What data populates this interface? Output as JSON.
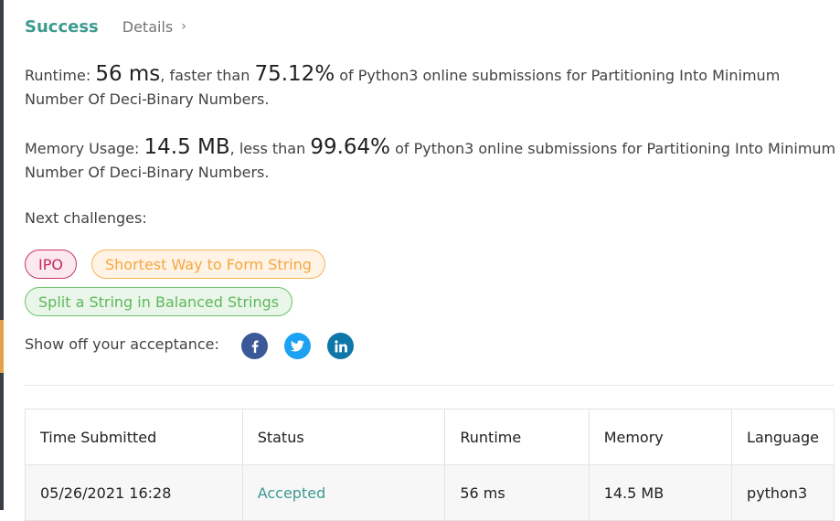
{
  "header": {
    "status": "Success",
    "details_label": "Details",
    "details_chevron": "›"
  },
  "runtime": {
    "label": "Runtime:",
    "value": "56 ms",
    "comparison": ", faster than",
    "percent": "75.12%",
    "description": "of Python3 online submissions for Partitioning Into Minimum Number Of Deci-Binary Numbers."
  },
  "memory": {
    "label": "Memory Usage:",
    "value": "14.5 MB",
    "comparison": ", less than",
    "percent": "99.64%",
    "description": "of Python3 online submissions for Partitioning Into Minimum Number Of Deci-Binary Numbers."
  },
  "next_challenges": {
    "label": "Next challenges:",
    "items": [
      {
        "label": "IPO",
        "difficulty_color": "#c12a5c"
      },
      {
        "label": "Shortest Way to Form String",
        "difficulty_color": "#f5a742"
      },
      {
        "label": "Split a String in Balanced Strings",
        "difficulty_color": "#5cb85c"
      }
    ]
  },
  "share": {
    "label": "Show off your acceptance:",
    "icons": [
      "facebook-icon",
      "twitter-icon",
      "linkedin-icon"
    ]
  },
  "submissions": {
    "columns": [
      "Time Submitted",
      "Status",
      "Runtime",
      "Memory",
      "Language"
    ],
    "rows": [
      {
        "time": "05/26/2021 16:28",
        "status": "Accepted",
        "runtime": "56 ms",
        "memory": "14.5 MB",
        "language": "python3"
      }
    ]
  },
  "colors": {
    "success": "#3e9a8f",
    "facebook": "#3b5998",
    "twitter": "#1da1f2",
    "linkedin": "#0e76a8"
  }
}
